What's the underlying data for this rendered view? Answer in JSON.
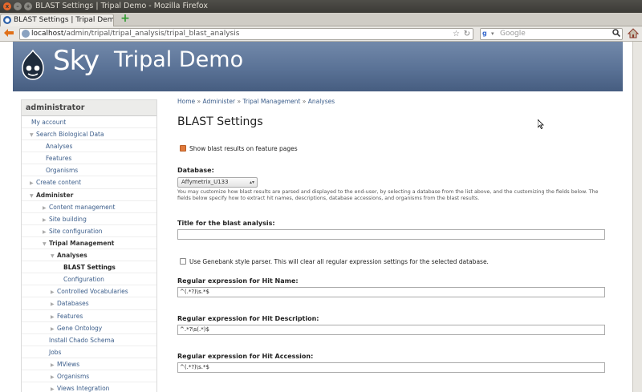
{
  "window": {
    "title": "BLAST Settings | Tripal Demo - Mozilla Firefox",
    "close": "x",
    "min": "–",
    "max": "+"
  },
  "tabs": [
    {
      "label": "BLAST Settings | Tripal Demo",
      "close": "×"
    }
  ],
  "new_tab_glyph": "+",
  "nav": {
    "url_host": "localhost",
    "url_path": "/admin/tripal/tripal_analysis/tripal_blast_analysis",
    "search_placeholder": "Google"
  },
  "site": {
    "logo_word": "Sky",
    "name": "Tripal Demo",
    "header_color": "#5a7296"
  },
  "sidebar": {
    "user": "administrator",
    "items": [
      {
        "label": "My account",
        "indent": 0,
        "arrow": ""
      },
      {
        "label": "Search Biological Data",
        "indent": 1,
        "arrow": "▼"
      },
      {
        "label": "Analyses",
        "indent": 2,
        "arrow": ""
      },
      {
        "label": "Features",
        "indent": 2,
        "arrow": ""
      },
      {
        "label": "Organisms",
        "indent": 2,
        "arrow": ""
      },
      {
        "label": "Create content",
        "indent": 1,
        "arrow": "▶"
      },
      {
        "label": "Administer",
        "indent": 1,
        "arrow": "▼",
        "style": "dark"
      },
      {
        "label": "Content management",
        "indent": 3,
        "arrow": "▶"
      },
      {
        "label": "Site building",
        "indent": 3,
        "arrow": "▶"
      },
      {
        "label": "Site configuration",
        "indent": 3,
        "arrow": "▶"
      },
      {
        "label": "Tripal Management",
        "indent": 3,
        "arrow": "▼",
        "style": "dark"
      },
      {
        "label": "Analyses",
        "indent": 4,
        "arrow": "▼",
        "style": "dark"
      },
      {
        "label": "BLAST Settings",
        "indent": 5,
        "arrow": "",
        "style": "active"
      },
      {
        "label": "Configuration",
        "indent": 5,
        "arrow": ""
      },
      {
        "label": "Controlled Vocabularies",
        "indent": 4,
        "arrow": "▶"
      },
      {
        "label": "Databases",
        "indent": 4,
        "arrow": "▶"
      },
      {
        "label": "Features",
        "indent": 4,
        "arrow": "▶"
      },
      {
        "label": "Gene Ontology",
        "indent": 4,
        "arrow": "▶"
      },
      {
        "label": "Install Chado Schema",
        "indent": 3,
        "arrow": ""
      },
      {
        "label": "Jobs",
        "indent": 3,
        "arrow": ""
      },
      {
        "label": "MViews",
        "indent": 4,
        "arrow": "▶"
      },
      {
        "label": "Organisms",
        "indent": 4,
        "arrow": "▶"
      },
      {
        "label": "Views Integration",
        "indent": 4,
        "arrow": "▶"
      }
    ]
  },
  "breadcrumb": [
    "Home",
    "Administer",
    "Tripal Management",
    "Analyses"
  ],
  "breadcrumb_sep": "»",
  "page_title": "BLAST Settings",
  "form": {
    "show_results_label": "Show blast results on feature pages",
    "show_results_checked": true,
    "database_label": "Database:",
    "database_value": "Affymetrix_U133",
    "database_desc": "You may customize how blast results are parsed and displayed to the end-user, by selecting a database from the list above, and the customizing the fields below. The fields below specify how to extract hit names, descriptions, database accessions, and organisms from the blast results.",
    "title_label": "Title for the blast analysis:",
    "title_value": "",
    "genbank_label": "Use Genebank style parser. This will clear all regular expression settings for the selected database.",
    "genbank_checked": false,
    "hit_name_label": "Regular expression for Hit Name:",
    "hit_name_value": "^(.*?)\\s.*$",
    "hit_desc_label": "Regular expression for Hit Description:",
    "hit_desc_value": "^.*?\\s(.*)$",
    "hit_acc_label": "Regular expression for Hit Accession:",
    "hit_acc_value": "^(.*?)\\s.*$"
  }
}
